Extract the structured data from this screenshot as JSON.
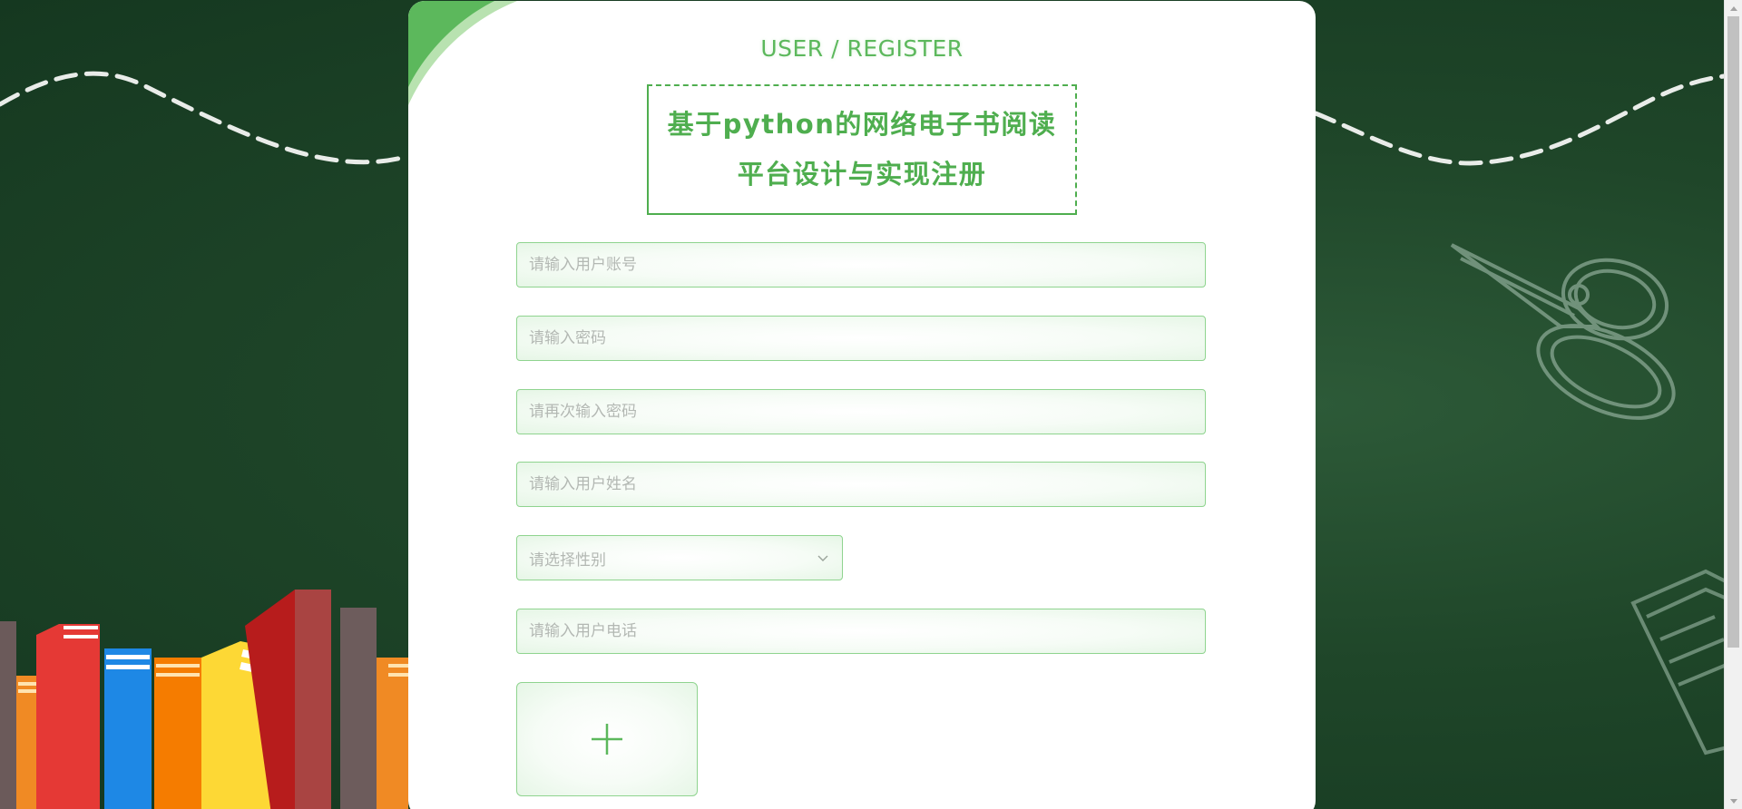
{
  "header": {
    "subtitle": "USER / REGISTER",
    "title_line1": "基于python的网络电子书阅读",
    "title_line2": "平台设计与实现注册"
  },
  "form": {
    "account_placeholder": "请输入用户账号",
    "password_placeholder": "请输入密码",
    "confirm_password_placeholder": "请再次输入密码",
    "name_placeholder": "请输入用户姓名",
    "gender_select_placeholder": "请选择性别",
    "phone_placeholder": "请输入用户电话",
    "upload_icon": "plus-icon"
  },
  "colors": {
    "accent": "#4fae4f",
    "field_border": "#8fd48f",
    "background": "#1f4629"
  }
}
